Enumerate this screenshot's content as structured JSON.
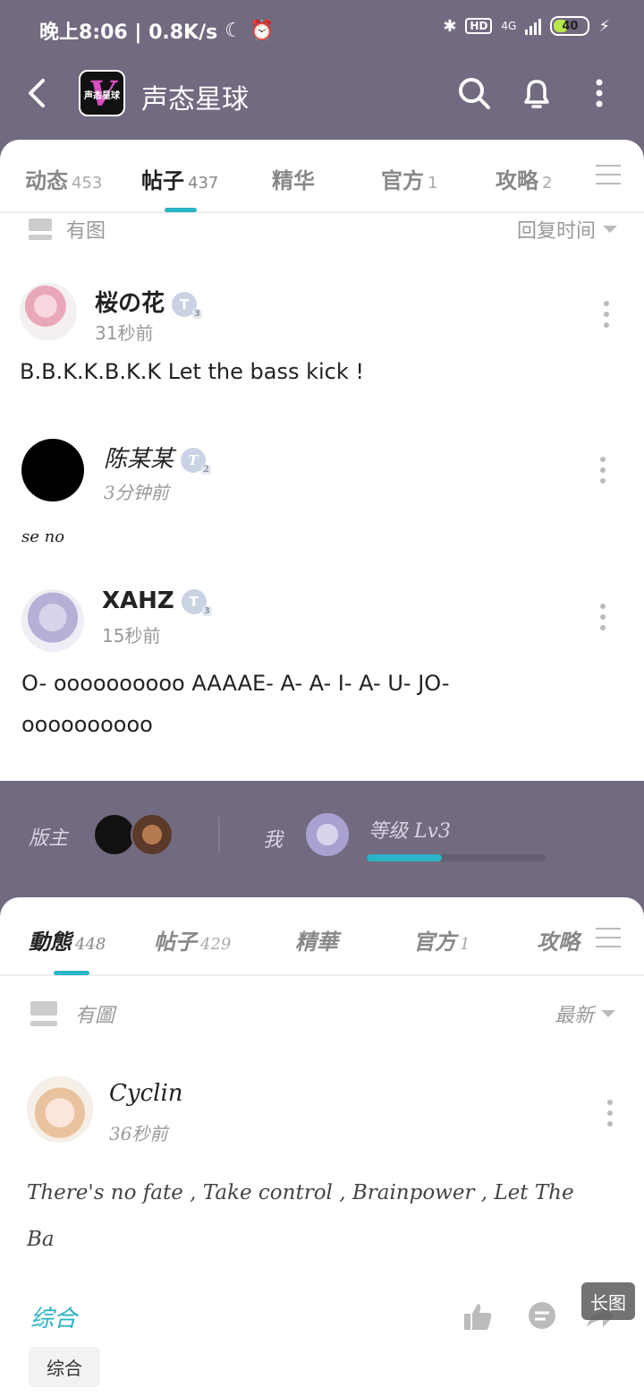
{
  "status": {
    "time": "晚上8:06 | 0.8K/s",
    "hd": "HD",
    "network": "4G",
    "battery": "40"
  },
  "header": {
    "title": "声态星球",
    "logo_text": "声态星球"
  },
  "tabs_top": [
    {
      "label": "动态",
      "count": "453"
    },
    {
      "label": "帖子",
      "count": "437"
    },
    {
      "label": "精华",
      "count": ""
    },
    {
      "label": "官方",
      "count": "1"
    },
    {
      "label": "攻略",
      "count": "2"
    }
  ],
  "filter_top": {
    "label": "有图",
    "sort": "回复时间"
  },
  "posts": [
    {
      "user": "桜の花",
      "badge": "T",
      "time": "31秒前",
      "text": "B.B.K.K.B.K.K Let the bass kick !"
    },
    {
      "user": "陈某某",
      "badge": "T",
      "time": "3分钟前",
      "text": "se no"
    },
    {
      "user": "XAHZ",
      "badge": "T",
      "time": "15秒前",
      "text": "O- oooooooooo AAAAE- A- A- I- A- U- JO-",
      "text2": "oooooooooo"
    }
  ],
  "band": {
    "moderator": "版主",
    "me": "我",
    "level": "等级 Lv3",
    "level_progress": 0.42
  },
  "tabs_bottom": [
    {
      "label": "動態",
      "count": "448"
    },
    {
      "label": "帖子",
      "count": "429"
    },
    {
      "label": "精華",
      "count": ""
    },
    {
      "label": "官方",
      "count": "1"
    },
    {
      "label": "攻略",
      "count": ""
    }
  ],
  "filter_bottom": {
    "label": "有圖",
    "sort": "最新"
  },
  "post_bottom": {
    "user": "Cyclin",
    "time": "36秒前",
    "text": "There's no fate , Take control , Brainpower , Let The",
    "text2": "Ba"
  },
  "footer": {
    "tag": "综合",
    "chip": "综合",
    "long_image": "长图"
  },
  "colors": {
    "accent": "#2bb3c6",
    "header_bg": "#726a80"
  }
}
